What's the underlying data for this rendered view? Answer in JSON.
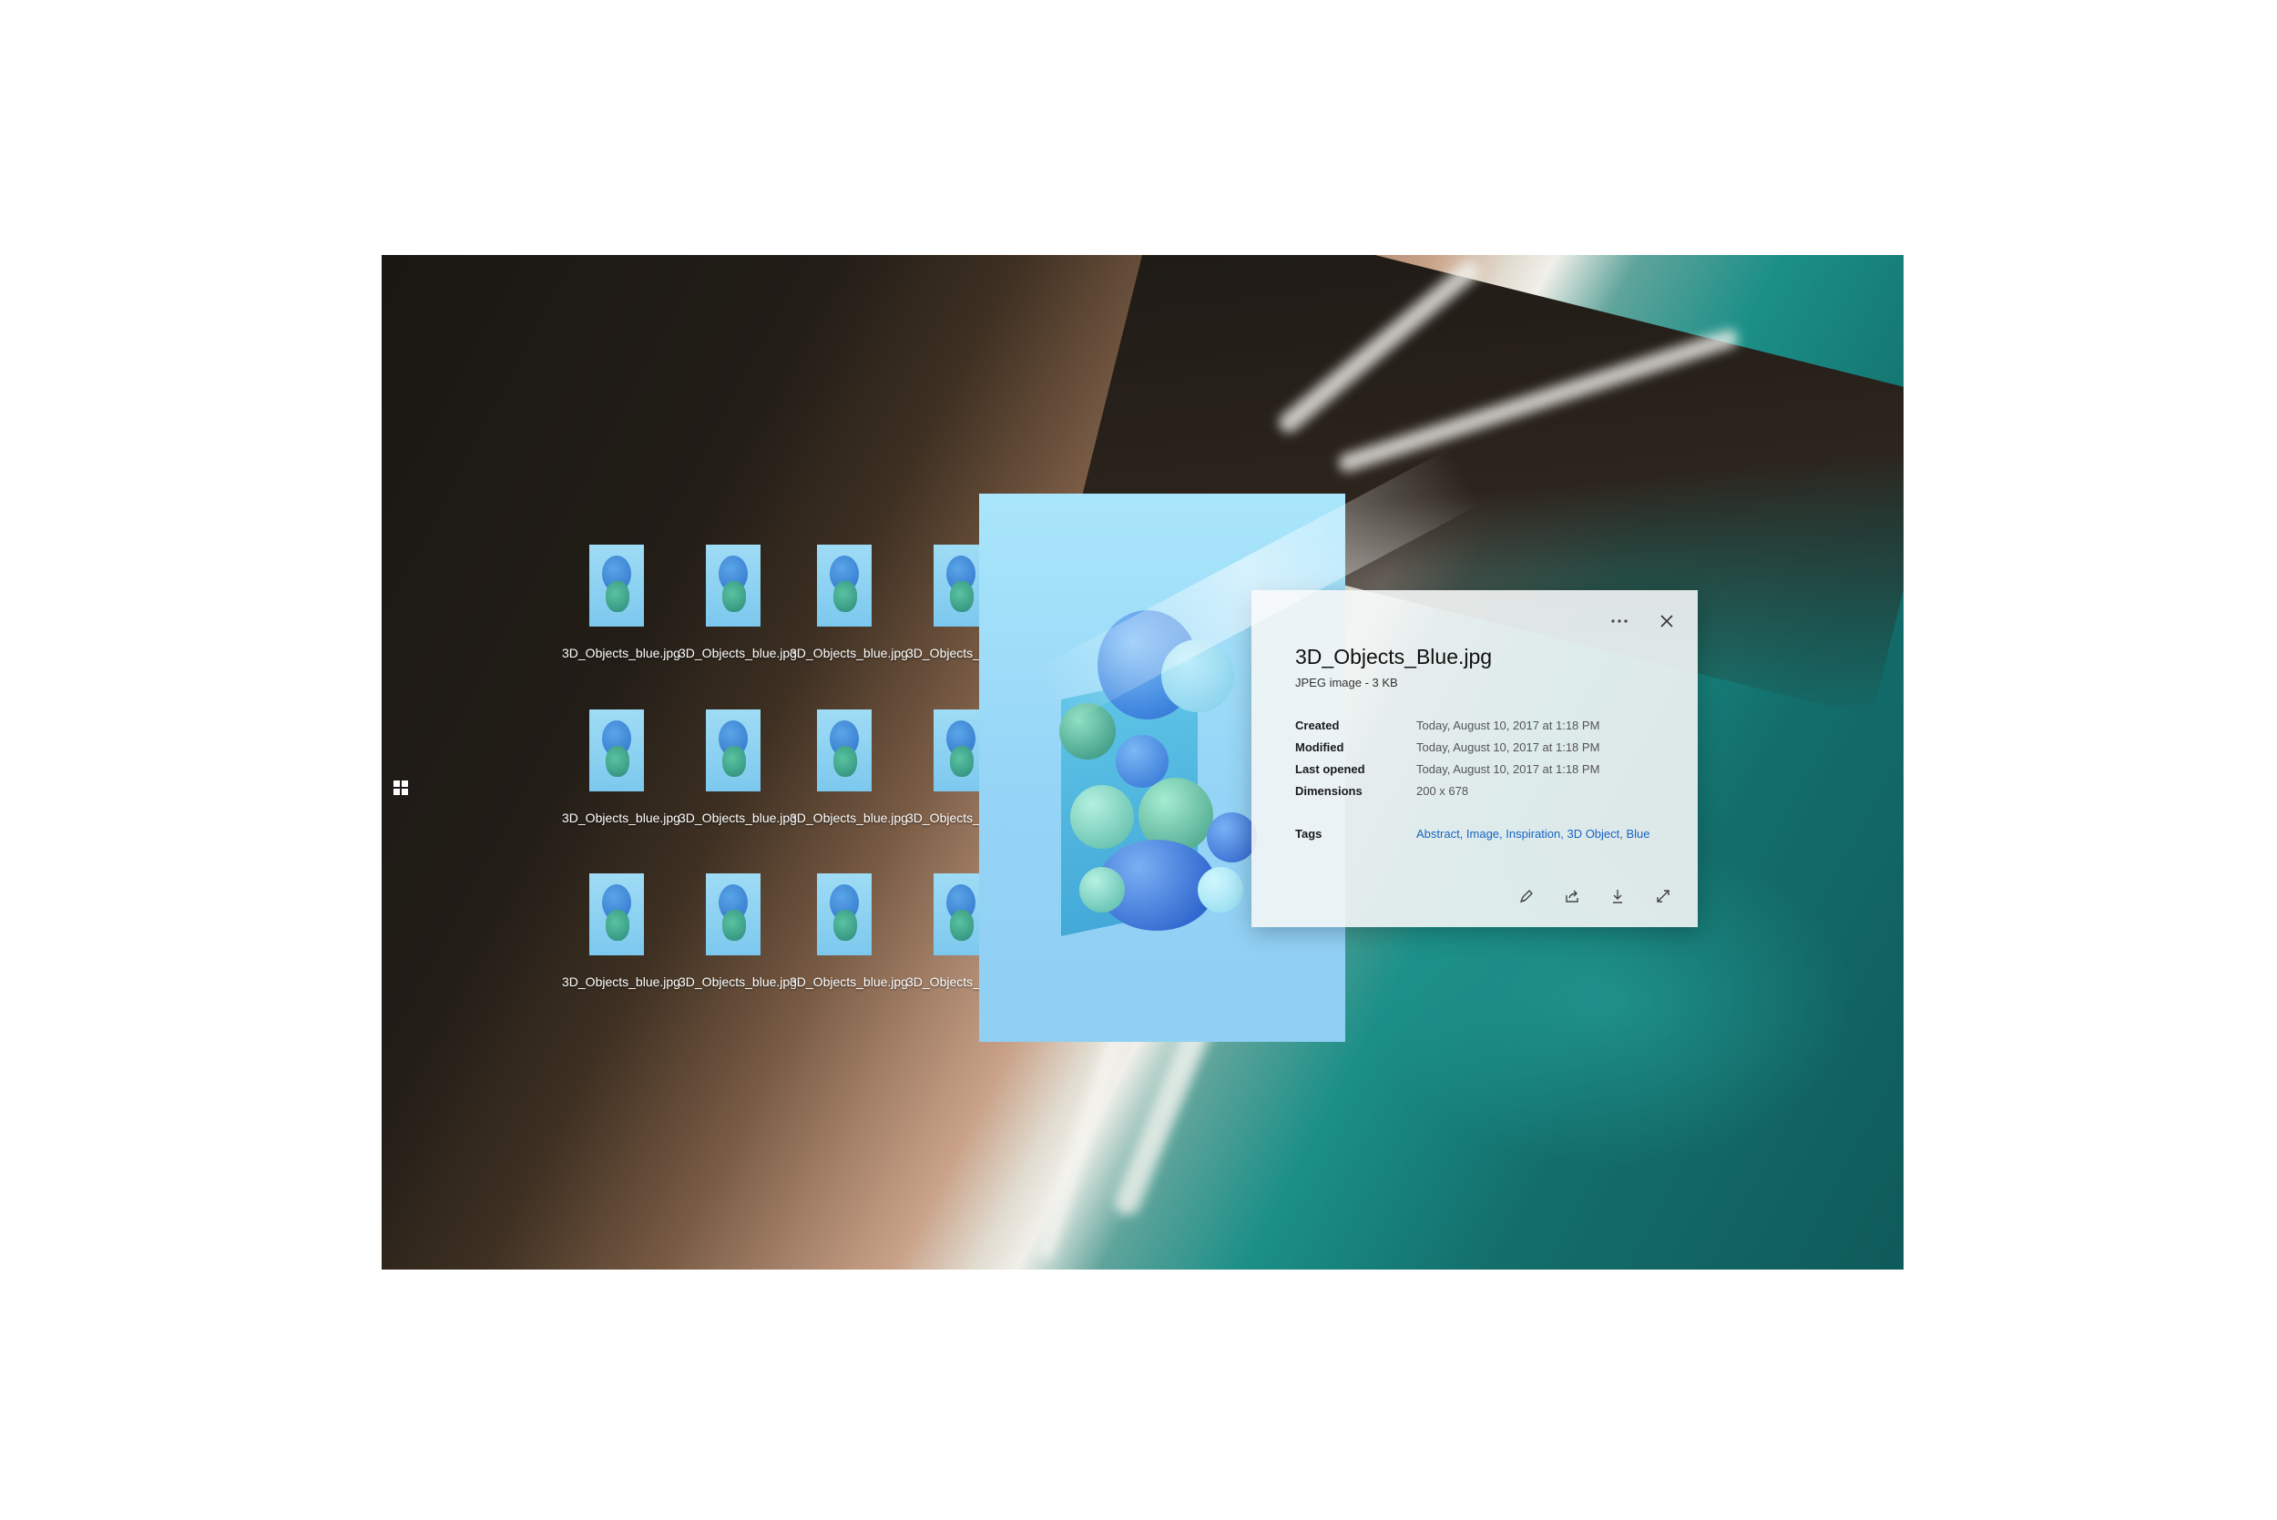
{
  "desktop": {
    "files": [
      {
        "label": "3D_Objects_blue.jpg"
      },
      {
        "label": "3D_Objects_blue.jpg"
      },
      {
        "label": "3D_Objects_blue.jpg"
      },
      {
        "label": "3D_Objects_blue.jpg"
      },
      {
        "label": "3D_Objects_blue.jpg"
      },
      {
        "label": "3D_Objects_blue.jpg"
      },
      {
        "label": "3D_Objects_blue.jpg"
      },
      {
        "label": "3D_Objects_blue.jpg"
      },
      {
        "label": "3D_Objects_blue.jpg"
      },
      {
        "label": "3D_Objects_blue.jpg"
      },
      {
        "label": "3D_Objects_blue.jpg"
      },
      {
        "label": "3D_Objects_blue.jpg"
      }
    ]
  },
  "panel": {
    "title": "3D_Objects_Blue.jpg",
    "subtitle": "JPEG image - 3 KB",
    "properties": [
      {
        "key": "Created",
        "value": "Today, August 10, 2017 at 1:18 PM"
      },
      {
        "key": "Modified",
        "value": "Today, August 10, 2017 at 1:18 PM"
      },
      {
        "key": "Last opened",
        "value": "Today, August 10, 2017 at 1:18 PM"
      },
      {
        "key": "Dimensions",
        "value": "200 x 678"
      }
    ],
    "tags_label": "Tags",
    "tags": "Abstract, Image, Inspiration, 3D Object, Blue",
    "more_icon": "more-icon",
    "close_icon": "close-icon",
    "actions": [
      "pen-icon",
      "share-icon",
      "download-icon",
      "expand-icon"
    ]
  }
}
